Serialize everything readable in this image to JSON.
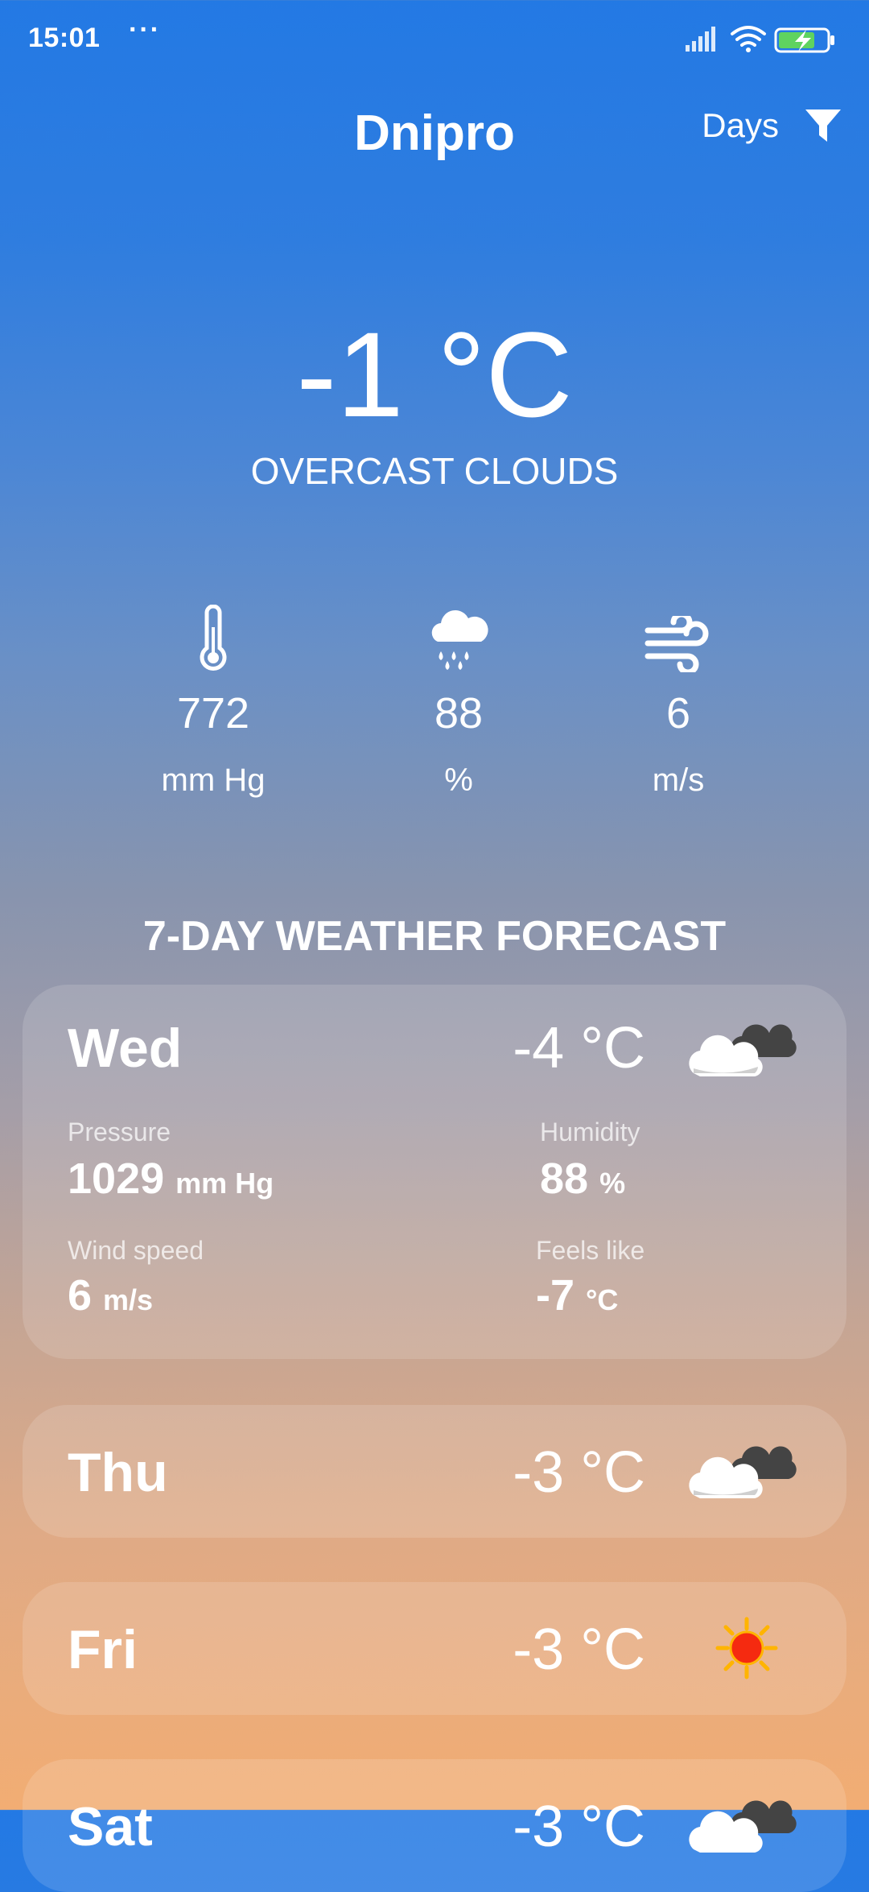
{
  "status_bar": {
    "time": "15:01",
    "dots": "···"
  },
  "header": {
    "city": "Dnipro",
    "days_label": "Days"
  },
  "current": {
    "temperature": "-1 °C",
    "condition": "OVERCAST CLOUDS",
    "stats": [
      {
        "icon": "thermometer-icon",
        "value": "772",
        "unit": "mm Hg"
      },
      {
        "icon": "rain-cloud-icon",
        "value": "88",
        "unit": "%"
      },
      {
        "icon": "wind-icon",
        "value": "6",
        "unit": "m/s"
      }
    ]
  },
  "forecast": {
    "title": "7-DAY WEATHER FORECAST",
    "days": [
      {
        "day": "Wed",
        "temp": "-4 °C",
        "icon": "cloud-icon",
        "details": {
          "pressure_label": "Pressure",
          "pressure": "1029",
          "pressure_unit": "mm Hg",
          "humidity_label": "Humidity",
          "humidity": "88",
          "humidity_unit": "%",
          "wind_label": "Wind speed",
          "wind": "6",
          "wind_unit": "m/s",
          "feels_label": "Feels like",
          "feels": "-7",
          "feels_unit": "°C"
        }
      },
      {
        "day": "Thu",
        "temp": "-3 °C",
        "icon": "cloud-icon"
      },
      {
        "day": "Fri",
        "temp": "-3 °C",
        "icon": "sun-icon"
      },
      {
        "day": "Sat",
        "temp": "-3 °C",
        "icon": "cloud-icon"
      }
    ]
  },
  "colors": {
    "top": "#2379e4",
    "bottom": "#f2ad73",
    "sun": "#f52a10"
  }
}
